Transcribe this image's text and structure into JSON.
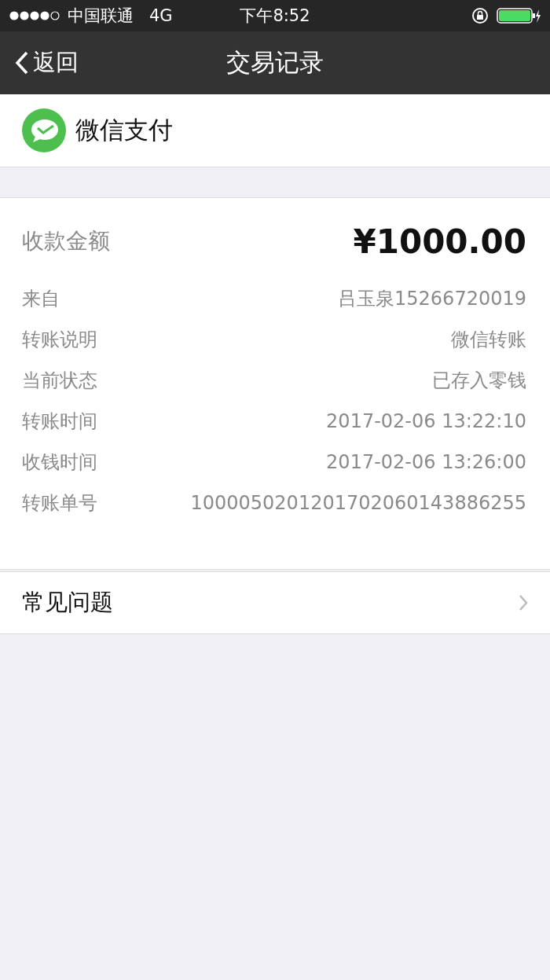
{
  "status_bar": {
    "carrier": "中国联通",
    "network": "4G",
    "time": "下午8:52"
  },
  "nav": {
    "back": "返回",
    "title": "交易记录"
  },
  "merchant": {
    "name": "微信支付"
  },
  "amount": {
    "label": "收款金额",
    "value": "¥1000.00"
  },
  "details": [
    {
      "label": "来自",
      "value": "吕玉泉15266720019"
    },
    {
      "label": "转账说明",
      "value": "微信转账"
    },
    {
      "label": "当前状态",
      "value": "已存入零钱"
    },
    {
      "label": "转账时间",
      "value": "2017-02-06 13:22:10"
    },
    {
      "label": "收钱时间",
      "value": "2017-02-06 13:26:00"
    },
    {
      "label": "转账单号",
      "value": "1000050201201702060143886255"
    }
  ],
  "faq": {
    "label": "常见问题"
  }
}
